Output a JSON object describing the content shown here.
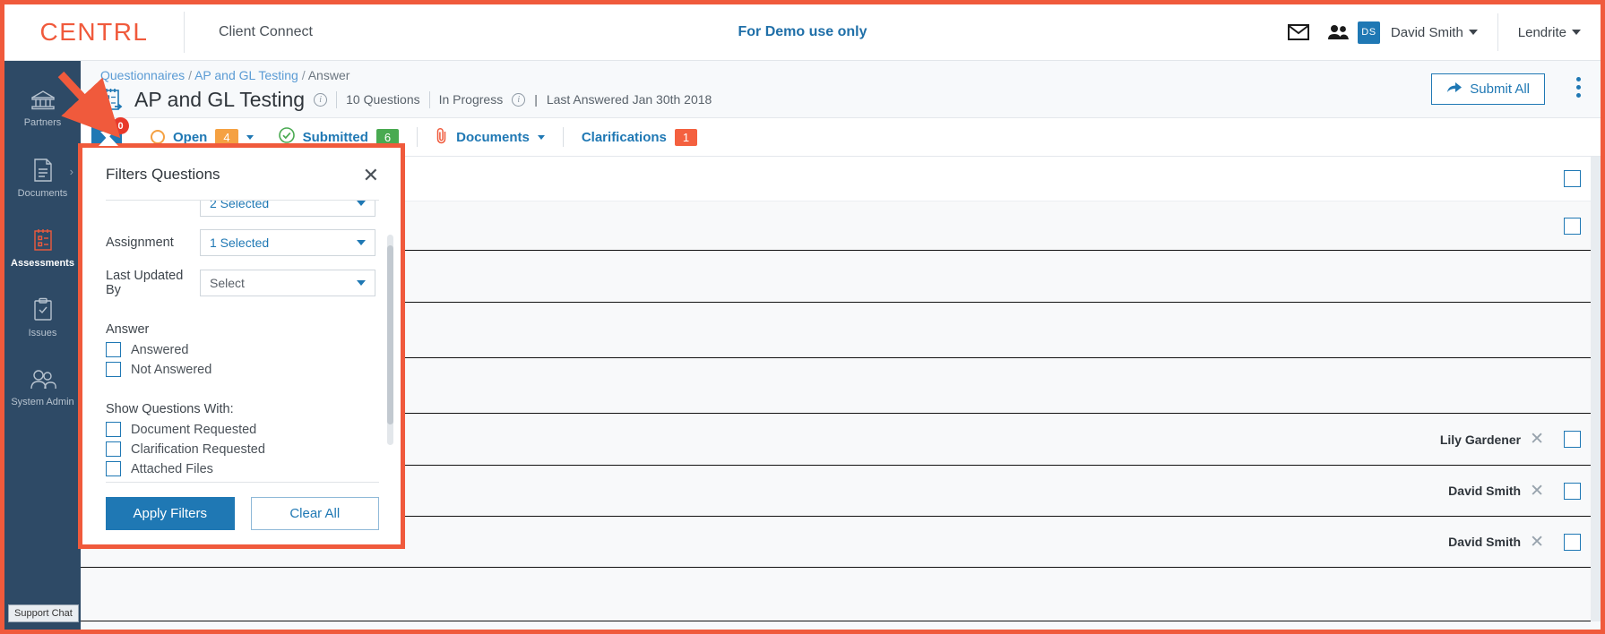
{
  "brand": {
    "logo": "CENTRL",
    "accent": "#f05a3c",
    "primary": "#1f78b4"
  },
  "topbar": {
    "app_name": "Client Connect",
    "demo_note": "For Demo use only",
    "mail_icon": "envelope-icon",
    "people_icon": "users-icon",
    "avatar_initials": "DS",
    "user_name": "David Smith",
    "tenant_name": "Lendrite"
  },
  "sidebar": {
    "items": [
      {
        "label": "Partners",
        "icon": "bank-icon",
        "active": false,
        "has_chevron": false
      },
      {
        "label": "Documents",
        "icon": "document-icon",
        "active": false,
        "has_chevron": true
      },
      {
        "label": "Assessments",
        "icon": "clipboard-list-icon",
        "active": true,
        "has_chevron": false
      },
      {
        "label": "Issues",
        "icon": "clipboard-check-icon",
        "active": false,
        "has_chevron": false
      },
      {
        "label": "System Admin",
        "icon": "people-admin-icon",
        "active": false,
        "has_chevron": false
      }
    ],
    "support_chat": "Support Chat"
  },
  "page": {
    "breadcrumb": {
      "root": "Questionnaires",
      "parent": "AP and GL Testing",
      "current": "Answer",
      "sep": "/"
    },
    "title": "AP and GL Testing",
    "question_count": "10 Questions",
    "status": "In Progress",
    "last_answered": "Last Answered Jan 30th 2018",
    "submit_all_label": "Submit All",
    "kebab": "more-options-icon"
  },
  "tabs": {
    "filter_icon": "filter-icon",
    "filter_badge": "0",
    "items": [
      {
        "label": "Open",
        "count": "4",
        "count_color": "#f5a142",
        "icon": "circle-outline-icon",
        "has_caret": true
      },
      {
        "label": "Submitted",
        "count": "6",
        "count_color": "#49aa51",
        "icon": "check-circle-icon",
        "has_caret": false
      },
      {
        "label": "Documents",
        "count": "",
        "count_color": "",
        "icon": "paperclip-icon",
        "has_caret": true
      },
      {
        "label": "Clarifications",
        "count": "1",
        "count_color": "#f4603f",
        "icon": "",
        "has_caret": false
      }
    ]
  },
  "rows": [
    {
      "assignee": "",
      "checkbox": true
    },
    {
      "assignee": "",
      "checkbox": true
    },
    {
      "assignee": "",
      "checkbox": false
    },
    {
      "assignee": "",
      "checkbox": false
    },
    {
      "assignee": "",
      "checkbox": false
    },
    {
      "assignee": "Lily Gardener",
      "checkbox": true
    },
    {
      "assignee": "David Smith",
      "checkbox": true
    },
    {
      "assignee": "David Smith",
      "checkbox": true
    },
    {
      "assignee": "",
      "checkbox": false
    }
  ],
  "filter_popup": {
    "title": "Filters Questions",
    "close_icon": "close-icon",
    "fields": [
      {
        "label": "",
        "value": "2 Selected",
        "is_placeholder": false,
        "clipped": true
      },
      {
        "label": "Assignment",
        "value": "1 Selected",
        "is_placeholder": false,
        "clipped": false
      },
      {
        "label": "Last Updated By",
        "value": "Select",
        "is_placeholder": true,
        "clipped": false
      }
    ],
    "answer_group": {
      "title": "Answer",
      "options": [
        {
          "label": "Answered",
          "checked": false
        },
        {
          "label": "Not Answered",
          "checked": false
        }
      ]
    },
    "show_group": {
      "title": "Show Questions With:",
      "options": [
        {
          "label": "Document Requested",
          "checked": false
        },
        {
          "label": "Clarification Requested",
          "checked": false
        },
        {
          "label": "Attached Files",
          "checked": false
        }
      ]
    },
    "apply_label": "Apply Filters",
    "clear_label": "Clear All"
  }
}
